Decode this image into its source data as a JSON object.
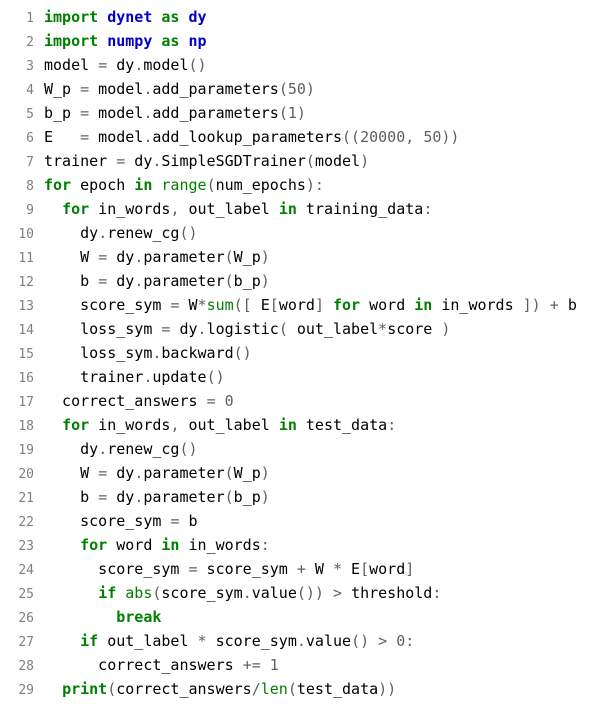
{
  "code": {
    "lines": [
      {
        "n": "1",
        "tokens": [
          [
            "kw",
            "import"
          ],
          [
            "",
            null
          ],
          [
            "mod",
            "dynet"
          ],
          [
            "",
            null
          ],
          [
            "kw",
            "as"
          ],
          [
            "",
            null
          ],
          [
            "mod",
            "dy"
          ]
        ]
      },
      {
        "n": "2",
        "tokens": [
          [
            "kw",
            "import"
          ],
          [
            "",
            null
          ],
          [
            "mod",
            "numpy"
          ],
          [
            "",
            null
          ],
          [
            "kw",
            "as"
          ],
          [
            "",
            null
          ],
          [
            "mod",
            "np"
          ]
        ]
      },
      {
        "n": "3",
        "tokens": [
          [
            "",
            "model "
          ],
          [
            "op",
            "="
          ],
          [
            "",
            " dy"
          ],
          [
            "op",
            "."
          ],
          [
            "",
            "model"
          ],
          [
            "op",
            "()"
          ]
        ]
      },
      {
        "n": "4",
        "tokens": [
          [
            "",
            "W_p "
          ],
          [
            "op",
            "="
          ],
          [
            "",
            " model"
          ],
          [
            "op",
            "."
          ],
          [
            "",
            "add_parameters"
          ],
          [
            "op",
            "("
          ],
          [
            "num",
            "50"
          ],
          [
            "op",
            ")"
          ]
        ]
      },
      {
        "n": "5",
        "tokens": [
          [
            "",
            "b_p "
          ],
          [
            "op",
            "="
          ],
          [
            "",
            " model"
          ],
          [
            "op",
            "."
          ],
          [
            "",
            "add_parameters"
          ],
          [
            "op",
            "("
          ],
          [
            "num",
            "1"
          ],
          [
            "op",
            ")"
          ]
        ]
      },
      {
        "n": "6",
        "tokens": [
          [
            "",
            "E   "
          ],
          [
            "op",
            "="
          ],
          [
            "",
            " model"
          ],
          [
            "op",
            "."
          ],
          [
            "",
            "add_lookup_parameters"
          ],
          [
            "op",
            "(("
          ],
          [
            "num",
            "20000"
          ],
          [
            "op",
            ", "
          ],
          [
            "num",
            "50"
          ],
          [
            "op",
            "))"
          ]
        ]
      },
      {
        "n": "7",
        "tokens": [
          [
            "",
            "trainer "
          ],
          [
            "op",
            "="
          ],
          [
            "",
            " dy"
          ],
          [
            "op",
            "."
          ],
          [
            "",
            "SimpleSGDTrainer"
          ],
          [
            "op",
            "("
          ],
          [
            "",
            "model"
          ],
          [
            "op",
            ")"
          ]
        ]
      },
      {
        "n": "8",
        "tokens": [
          [
            "kw",
            "for"
          ],
          [
            "",
            " epoch "
          ],
          [
            "kw",
            "in"
          ],
          [
            "",
            " "
          ],
          [
            "bi",
            "range"
          ],
          [
            "op",
            "("
          ],
          [
            "",
            "num_epochs"
          ],
          [
            "op",
            "):"
          ]
        ]
      },
      {
        "n": "9",
        "tokens": [
          [
            "",
            "  "
          ],
          [
            "kw",
            "for"
          ],
          [
            "",
            " in_words"
          ],
          [
            "op",
            ", "
          ],
          [
            "",
            "out_label "
          ],
          [
            "kw",
            "in"
          ],
          [
            "",
            " training_data"
          ],
          [
            "op",
            ":"
          ]
        ]
      },
      {
        "n": "10",
        "tokens": [
          [
            "",
            "    dy"
          ],
          [
            "op",
            "."
          ],
          [
            "",
            "renew_cg"
          ],
          [
            "op",
            "()"
          ]
        ]
      },
      {
        "n": "11",
        "tokens": [
          [
            "",
            "    W "
          ],
          [
            "op",
            "="
          ],
          [
            "",
            " dy"
          ],
          [
            "op",
            "."
          ],
          [
            "",
            "parameter"
          ],
          [
            "op",
            "("
          ],
          [
            "",
            "W_p"
          ],
          [
            "op",
            ")"
          ]
        ]
      },
      {
        "n": "12",
        "tokens": [
          [
            "",
            "    b "
          ],
          [
            "op",
            "="
          ],
          [
            "",
            " dy"
          ],
          [
            "op",
            "."
          ],
          [
            "",
            "parameter"
          ],
          [
            "op",
            "("
          ],
          [
            "",
            "b_p"
          ],
          [
            "op",
            ")"
          ]
        ]
      },
      {
        "n": "13",
        "tokens": [
          [
            "",
            "    score_sym "
          ],
          [
            "op",
            "="
          ],
          [
            "",
            " W"
          ],
          [
            "op",
            "*"
          ],
          [
            "bi",
            "sum"
          ],
          [
            "op",
            "(["
          ],
          [
            "",
            " E"
          ],
          [
            "op",
            "["
          ],
          [
            "",
            "word"
          ],
          [
            "op",
            "] "
          ],
          [
            "kw",
            "for"
          ],
          [
            "",
            " word "
          ],
          [
            "kw",
            "in"
          ],
          [
            "",
            " in_words "
          ],
          [
            "op",
            "]) + "
          ],
          [
            "",
            "b"
          ]
        ]
      },
      {
        "n": "14",
        "tokens": [
          [
            "",
            "    loss_sym "
          ],
          [
            "op",
            "="
          ],
          [
            "",
            " dy"
          ],
          [
            "op",
            "."
          ],
          [
            "",
            "logistic"
          ],
          [
            "op",
            "( "
          ],
          [
            "",
            "out_label"
          ],
          [
            "op",
            "*"
          ],
          [
            "",
            "score "
          ],
          [
            "op",
            ")"
          ]
        ]
      },
      {
        "n": "15",
        "tokens": [
          [
            "",
            "    loss_sym"
          ],
          [
            "op",
            "."
          ],
          [
            "",
            "backward"
          ],
          [
            "op",
            "()"
          ]
        ]
      },
      {
        "n": "16",
        "tokens": [
          [
            "",
            "    trainer"
          ],
          [
            "op",
            "."
          ],
          [
            "",
            "update"
          ],
          [
            "op",
            "()"
          ]
        ]
      },
      {
        "n": "17",
        "tokens": [
          [
            "",
            "  correct_answers "
          ],
          [
            "op",
            "="
          ],
          [
            "",
            " "
          ],
          [
            "num",
            "0"
          ]
        ]
      },
      {
        "n": "18",
        "tokens": [
          [
            "",
            "  "
          ],
          [
            "kw",
            "for"
          ],
          [
            "",
            " in_words"
          ],
          [
            "op",
            ", "
          ],
          [
            "",
            "out_label "
          ],
          [
            "kw",
            "in"
          ],
          [
            "",
            " test_data"
          ],
          [
            "op",
            ":"
          ]
        ]
      },
      {
        "n": "19",
        "tokens": [
          [
            "",
            "    dy"
          ],
          [
            "op",
            "."
          ],
          [
            "",
            "renew_cg"
          ],
          [
            "op",
            "()"
          ]
        ]
      },
      {
        "n": "20",
        "tokens": [
          [
            "",
            "    W "
          ],
          [
            "op",
            "="
          ],
          [
            "",
            " dy"
          ],
          [
            "op",
            "."
          ],
          [
            "",
            "parameter"
          ],
          [
            "op",
            "("
          ],
          [
            "",
            "W_p"
          ],
          [
            "op",
            ")"
          ]
        ]
      },
      {
        "n": "21",
        "tokens": [
          [
            "",
            "    b "
          ],
          [
            "op",
            "="
          ],
          [
            "",
            " dy"
          ],
          [
            "op",
            "."
          ],
          [
            "",
            "parameter"
          ],
          [
            "op",
            "("
          ],
          [
            "",
            "b_p"
          ],
          [
            "op",
            ")"
          ]
        ]
      },
      {
        "n": "22",
        "tokens": [
          [
            "",
            "    score_sym "
          ],
          [
            "op",
            "="
          ],
          [
            "",
            " b"
          ]
        ]
      },
      {
        "n": "23",
        "tokens": [
          [
            "",
            "    "
          ],
          [
            "kw",
            "for"
          ],
          [
            "",
            " word "
          ],
          [
            "kw",
            "in"
          ],
          [
            "",
            " in_words"
          ],
          [
            "op",
            ":"
          ]
        ]
      },
      {
        "n": "24",
        "tokens": [
          [
            "",
            "      score_sym "
          ],
          [
            "op",
            "="
          ],
          [
            "",
            " score_sym "
          ],
          [
            "op",
            "+"
          ],
          [
            "",
            " W "
          ],
          [
            "op",
            "*"
          ],
          [
            "",
            " E"
          ],
          [
            "op",
            "["
          ],
          [
            "",
            "word"
          ],
          [
            "op",
            "]"
          ]
        ]
      },
      {
        "n": "25",
        "tokens": [
          [
            "",
            "      "
          ],
          [
            "kw",
            "if"
          ],
          [
            "",
            " "
          ],
          [
            "bi",
            "abs"
          ],
          [
            "op",
            "("
          ],
          [
            "",
            "score_sym"
          ],
          [
            "op",
            "."
          ],
          [
            "",
            "value"
          ],
          [
            "op",
            "()) > "
          ],
          [
            "",
            "threshold"
          ],
          [
            "op",
            ":"
          ]
        ]
      },
      {
        "n": "26",
        "tokens": [
          [
            "",
            "        "
          ],
          [
            "kw",
            "break"
          ]
        ]
      },
      {
        "n": "27",
        "tokens": [
          [
            "",
            "    "
          ],
          [
            "kw",
            "if"
          ],
          [
            "",
            " out_label "
          ],
          [
            "op",
            "*"
          ],
          [
            "",
            " score_sym"
          ],
          [
            "op",
            "."
          ],
          [
            "",
            "value"
          ],
          [
            "op",
            "() > "
          ],
          [
            "num",
            "0"
          ],
          [
            "op",
            ":"
          ]
        ]
      },
      {
        "n": "28",
        "tokens": [
          [
            "",
            "      correct_answers "
          ],
          [
            "op",
            "+="
          ],
          [
            "",
            " "
          ],
          [
            "num",
            "1"
          ]
        ]
      },
      {
        "n": "29",
        "tokens": [
          [
            "",
            "  "
          ],
          [
            "kw",
            "print"
          ],
          [
            "op",
            "("
          ],
          [
            "",
            "correct_answers"
          ],
          [
            "op",
            "/"
          ],
          [
            "bi",
            "len"
          ],
          [
            "op",
            "("
          ],
          [
            "",
            "test_data"
          ],
          [
            "op",
            "))"
          ]
        ]
      }
    ]
  }
}
